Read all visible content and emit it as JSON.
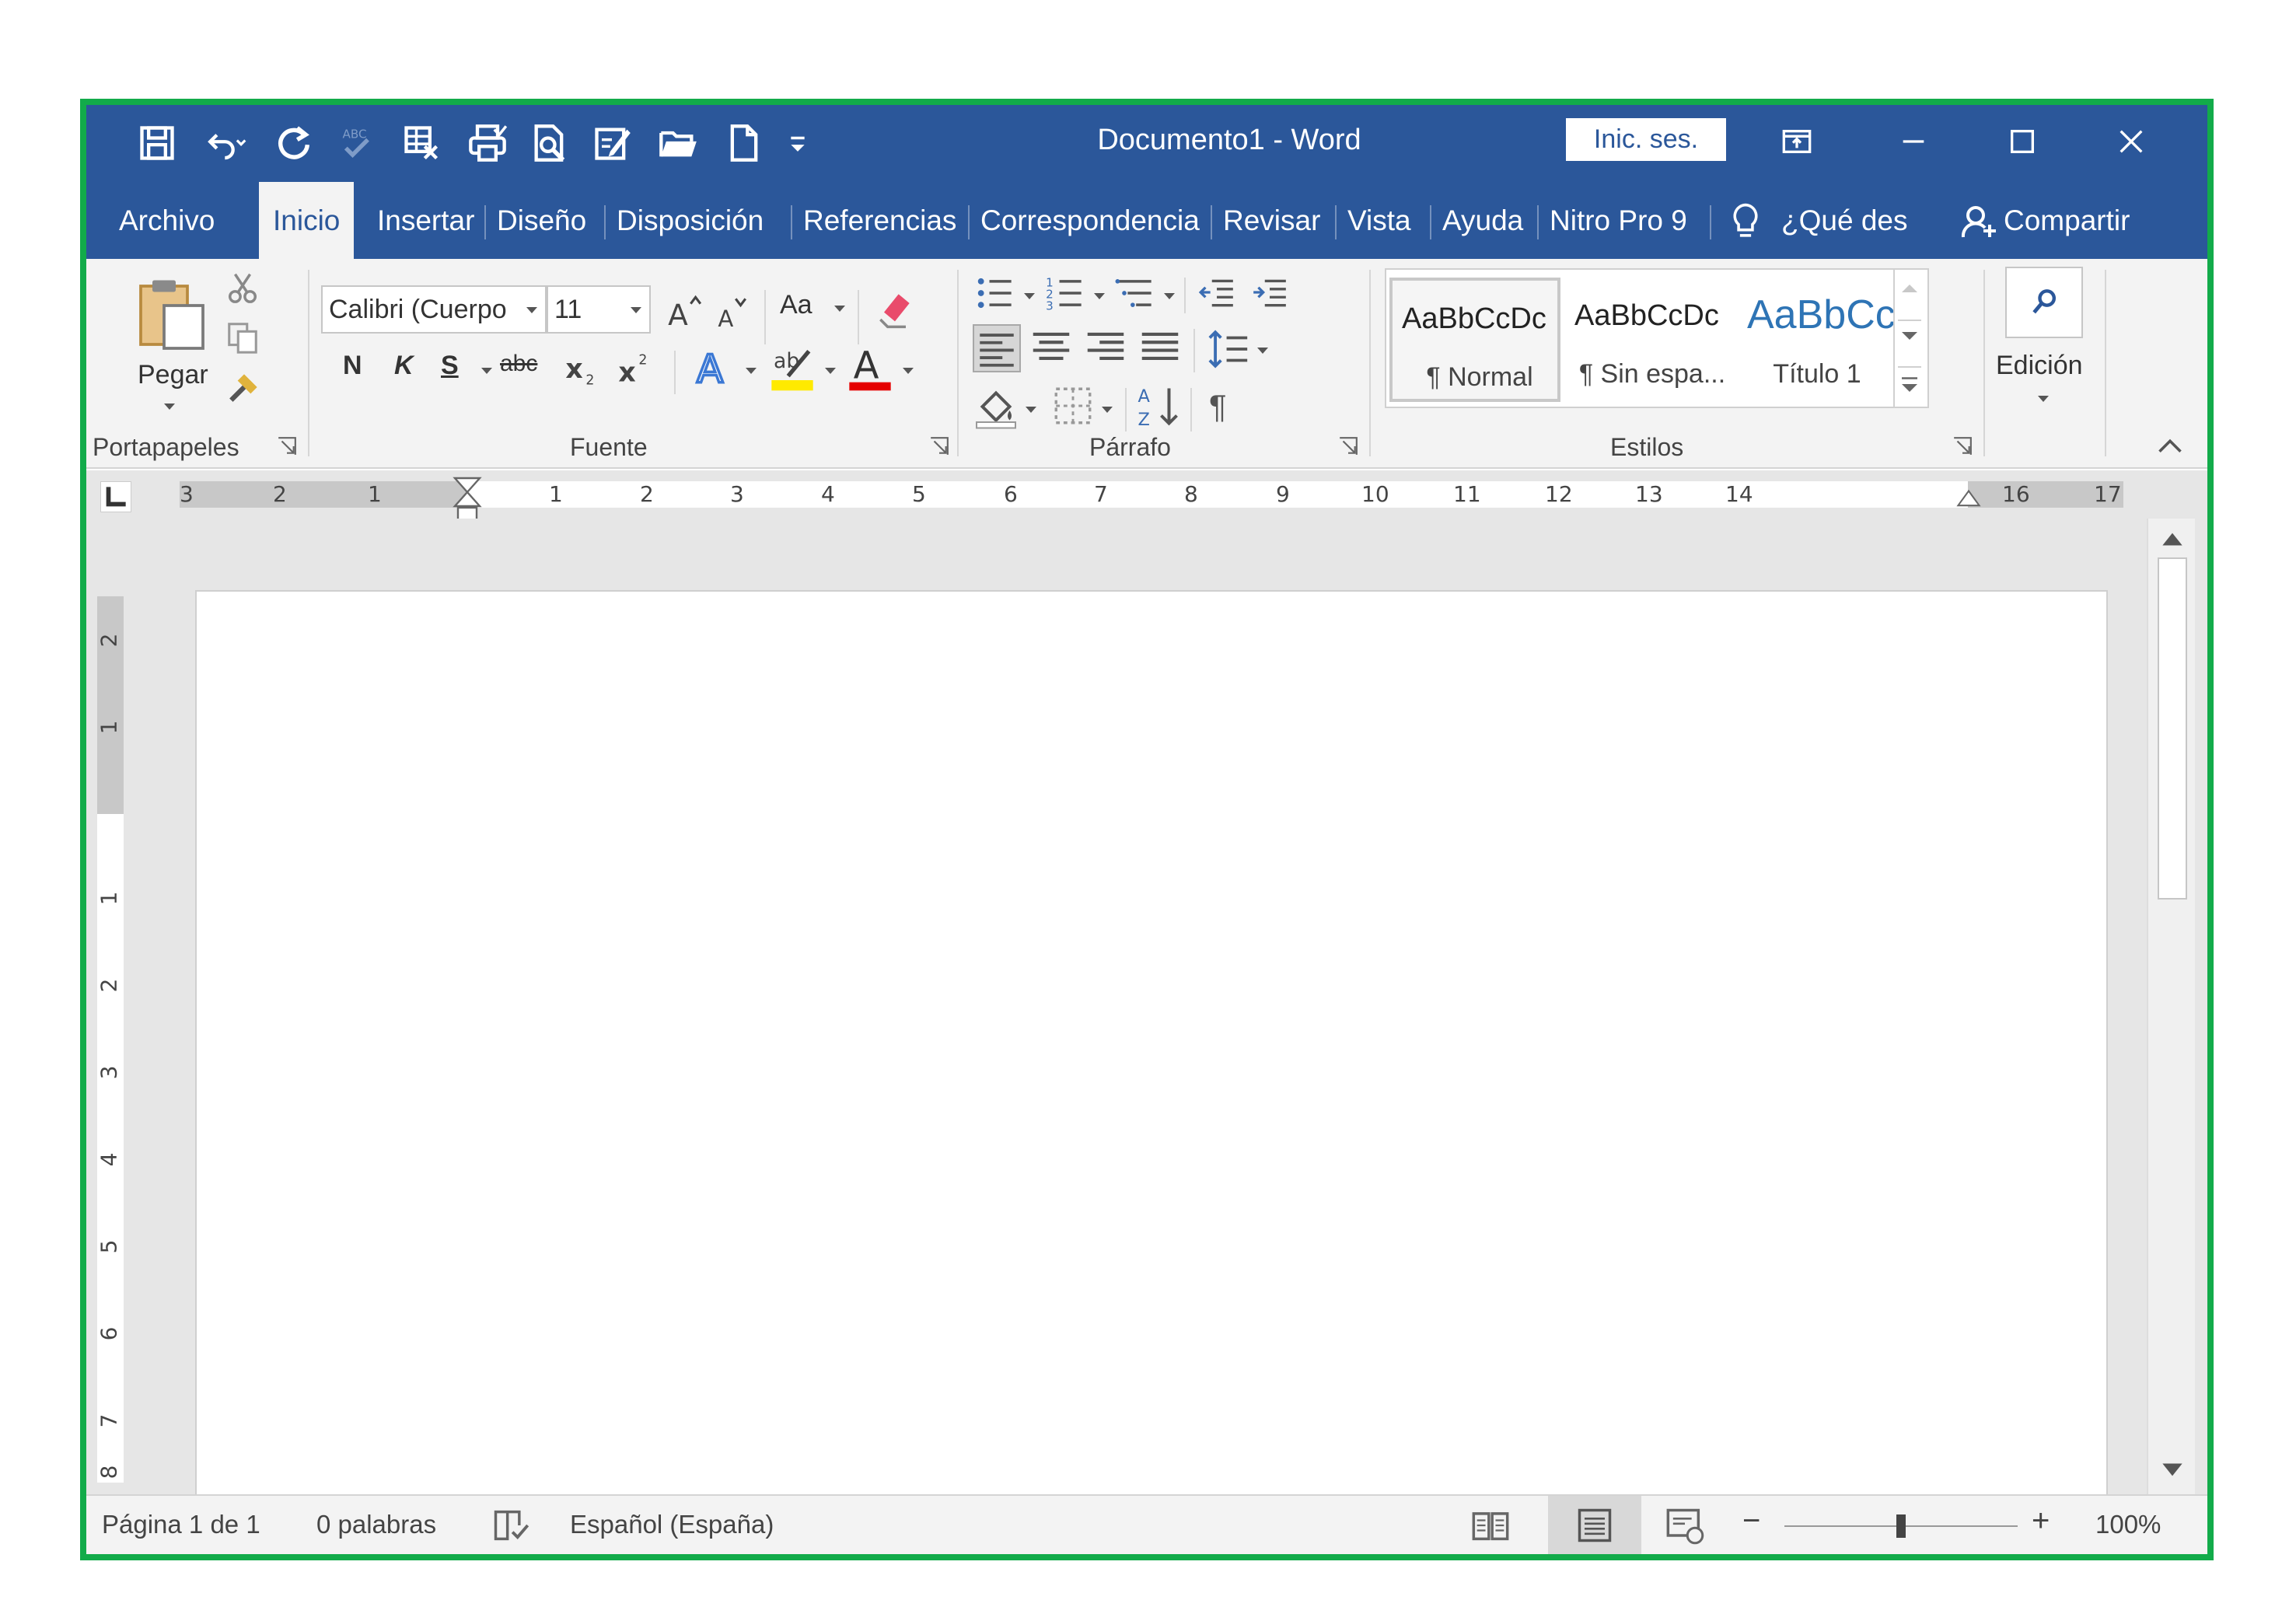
{
  "app": {
    "title": "Documento1  -  Word",
    "sign_in": "Inic. ses.",
    "accent_color": "#2b579a",
    "frame_color": "#12ab4a"
  },
  "qat": [
    {
      "icon": "save-icon"
    },
    {
      "icon": "undo-icon"
    },
    {
      "icon": "redo-icon"
    },
    {
      "icon": "spelling-icon"
    },
    {
      "icon": "table-icon"
    },
    {
      "icon": "print-icon"
    },
    {
      "icon": "print-preview-icon"
    },
    {
      "icon": "edit-document-icon"
    },
    {
      "icon": "open-folder-icon"
    },
    {
      "icon": "new-document-icon"
    },
    {
      "icon": "customize-qat-icon"
    }
  ],
  "tabs": [
    {
      "label": "Archivo",
      "active": false
    },
    {
      "label": "Inicio",
      "active": true
    },
    {
      "label": "Insertar",
      "active": false
    },
    {
      "label": "Diseño",
      "active": false
    },
    {
      "label": "Disposición",
      "active": false
    },
    {
      "label": "Referencias",
      "active": false
    },
    {
      "label": "Correspondencia",
      "active": false
    },
    {
      "label": "Revisar",
      "active": false
    },
    {
      "label": "Vista",
      "active": false
    },
    {
      "label": "Ayuda",
      "active": false
    },
    {
      "label": "Nitro Pro 9",
      "active": false
    }
  ],
  "tell_me": "¿Qué des",
  "share": "Compartir",
  "ribbon": {
    "clipboard": {
      "label": "Portapapeles",
      "paste": "Pegar"
    },
    "font": {
      "label": "Fuente",
      "font_name": "Calibri (Cuerpo",
      "font_size": "11",
      "change_case": "Aa",
      "bold": "N",
      "italic": "K",
      "underline": "S",
      "strike": "abc"
    },
    "paragraph": {
      "label": "Párrafo",
      "pilcrow": "¶"
    },
    "styles": {
      "label": "Estilos",
      "items": [
        {
          "sample": "AaBbCcDc",
          "name": "¶ Normal",
          "selected": true
        },
        {
          "sample": "AaBbCcDc",
          "name": "¶ Sin espa...",
          "selected": false
        },
        {
          "sample": "AaBbCc",
          "name": "Título 1",
          "selected": false,
          "color": "#2e74b5"
        }
      ]
    },
    "editing": {
      "label": "Edición"
    }
  },
  "ruler": {
    "left_numbers": [
      "3",
      "2",
      "1"
    ],
    "right_numbers": [
      "1",
      "2",
      "3",
      "4",
      "5",
      "6",
      "7",
      "8",
      "9",
      "10",
      "11",
      "12",
      "13",
      "14",
      "16",
      "17"
    ],
    "vertical_numbers": [
      "2",
      "1",
      "1",
      "2",
      "3",
      "4",
      "5",
      "6",
      "7",
      "8"
    ]
  },
  "status": {
    "page": "Página 1 de 1",
    "words": "0 palabras",
    "language": "Español (España)",
    "zoom": "100%"
  }
}
